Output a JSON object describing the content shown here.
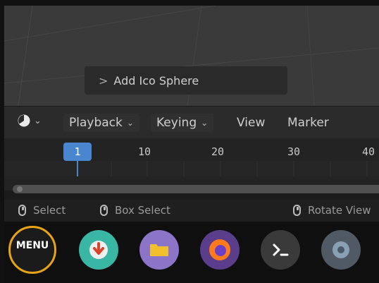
{
  "viewport": {
    "operator_panel": {
      "chevron": ">",
      "label": "Add Ico Sphere"
    }
  },
  "timeline_header": {
    "editor_caret": "⌄",
    "menus": [
      {
        "label": "Playback",
        "dropdown": "⌄"
      },
      {
        "label": "Keying",
        "dropdown": "⌄"
      },
      {
        "label": "View"
      },
      {
        "label": "Marker"
      }
    ]
  },
  "timeline": {
    "current_frame": "1",
    "frame_labels": [
      "10",
      "20",
      "30",
      "40"
    ],
    "left_arrow": ">"
  },
  "statusbar": {
    "items": [
      {
        "label": "Select",
        "icon": "mouse-left-icon"
      },
      {
        "label": "Box Select",
        "icon": "mouse-drag-icon"
      },
      {
        "label": "Rotate View",
        "icon": "mouse-middle-icon"
      }
    ]
  },
  "dock": {
    "menu_label": "MENU",
    "apps": [
      {
        "name": "software-updater",
        "color": "#3ab6a4"
      },
      {
        "name": "files",
        "color": "#8c74c9"
      },
      {
        "name": "firefox",
        "color": "#5a3e8c"
      },
      {
        "name": "terminal",
        "color": "#3a3a3a"
      },
      {
        "name": "settings",
        "color": "#505a64"
      }
    ]
  },
  "colors": {
    "accent_blue": "#4a85d0",
    "menu_ring": "#e8a413"
  }
}
